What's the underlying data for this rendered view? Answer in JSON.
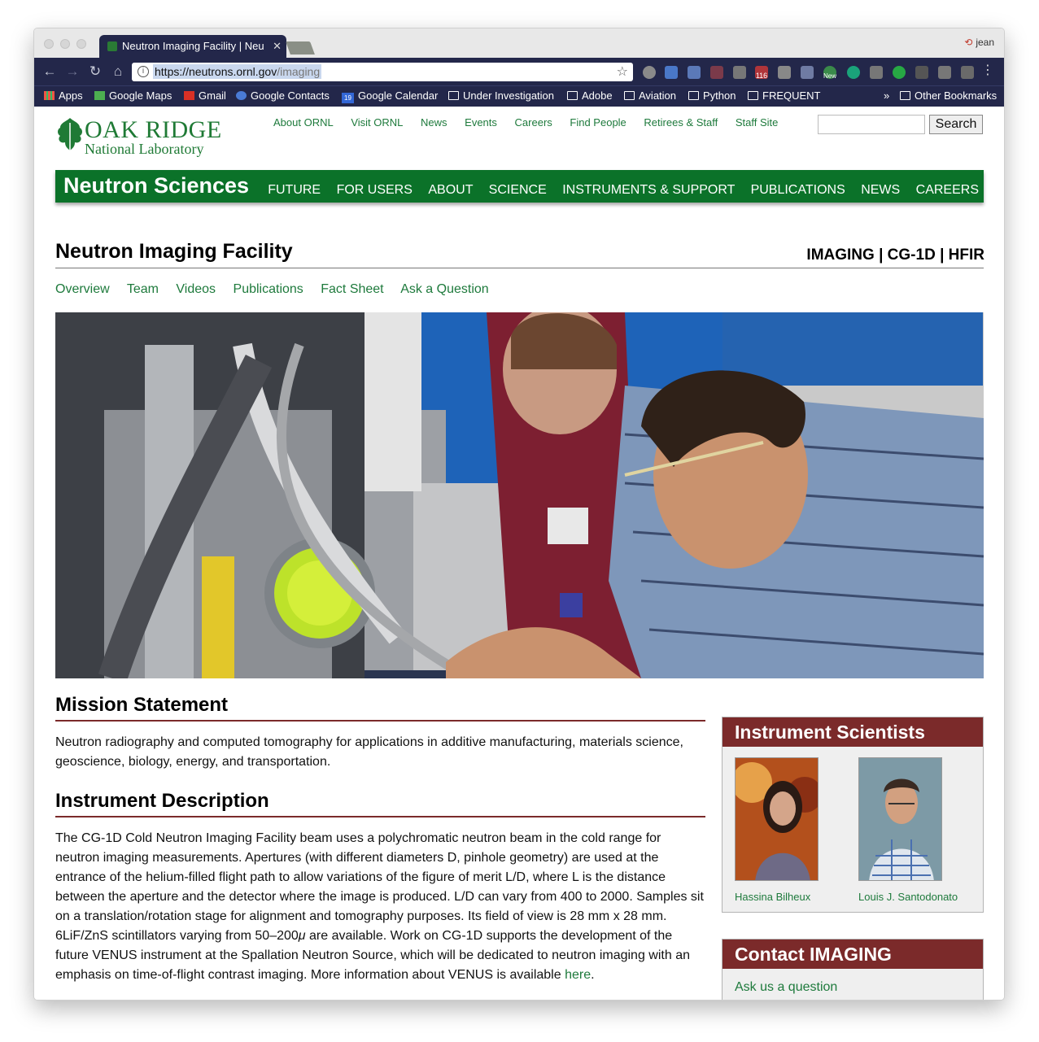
{
  "browser": {
    "tab_title": "Neutron Imaging Facility | Neu",
    "profile_name": "jean",
    "url_host": "https://neutrons.ornl.gov",
    "url_path": "/imaging",
    "bookmarks": [
      "Apps",
      "Google Maps",
      "Gmail",
      "Google Contacts",
      "Google Calendar",
      "Under Investigation",
      "Adobe",
      "Aviation",
      "Python",
      "FREQUENT"
    ],
    "calendar_day": "19",
    "overflow": "»",
    "other_bookmarks": "Other Bookmarks",
    "ext_badge_count": "116",
    "ext_new_badge": "New"
  },
  "site": {
    "logo_line1": "OAK RIDGE",
    "logo_line2": "National Laboratory",
    "top_links": [
      "About ORNL",
      "Visit ORNL",
      "News",
      "Events",
      "Careers",
      "Find People",
      "Retirees & Staff",
      "Staff Site"
    ],
    "search_button": "Search",
    "section_brand": "Neutron Sciences",
    "main_nav": [
      "FUTURE",
      "FOR USERS",
      "ABOUT",
      "SCIENCE",
      "INSTRUMENTS & SUPPORT",
      "PUBLICATIONS",
      "NEWS",
      "CAREERS"
    ]
  },
  "page": {
    "title": "Neutron Imaging Facility",
    "tagline": "IMAGING | CG-1D | HFIR",
    "sub_nav": [
      "Overview",
      "Team",
      "Videos",
      "Publications",
      "Fact Sheet",
      "Ask a Question"
    ],
    "mission_heading": "Mission Statement",
    "mission_text": "Neutron radiography and computed tomography for applications in additive manufacturing, materials science, geoscience, biology, energy, and transportation.",
    "description_heading": "Instrument Description",
    "description_text": "The CG-1D Cold Neutron Imaging Facility beam uses a polychromatic neutron beam in the cold range for neutron imaging measurements. Apertures (with different diameters D, pinhole geometry) are used at the entrance of the helium-filled flight path to allow variations of the figure of merit L/D, where L is the distance between the aperture and the detector where the image is produced. L/D can vary from 400 to 2000. Samples sit on a translation/rotation stage for alignment and tomography purposes. Its field of view is 28 mm x 28 mm. 6LiF/ZnS scintillators varying from 50–200",
    "description_mu": "μ",
    "description_text_2": " are available. Work on CG-1D supports the development of the future VENUS instrument at the Spallation Neutron Source, which will be dedicated to neutron imaging with an emphasis on time-of-flight contrast imaging. More information about VENUS is available ",
    "description_link": "here",
    "description_end": "."
  },
  "sidebar": {
    "scientists_heading": "Instrument Scientists",
    "scientists": [
      "Hassina Bilheux",
      "Louis J. Santodonato"
    ],
    "contact_heading": "Contact IMAGING",
    "contact_link": "Ask us a question"
  },
  "colors": {
    "ornl_green": "#0b7229",
    "link_green": "#1e7a3c",
    "maroon": "#7b2a2a",
    "chrome_navy": "#23274a"
  }
}
